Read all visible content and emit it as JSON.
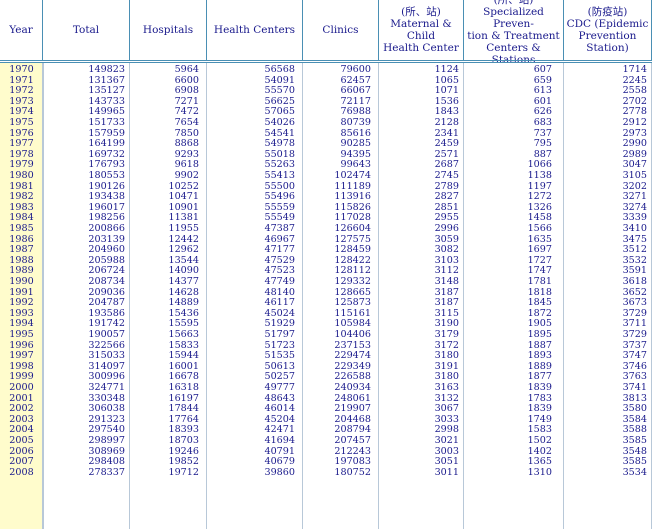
{
  "headers": [
    "Year",
    "Total",
    "Hospitals",
    "Health Centers",
    "Clinics",
    "(所、站)\nMaternal & Child\nHealth Center",
    "(所、站)\nSpecialized Preven-\ntion & Treatment\nCenters & Stations",
    "(防疫站)\nCDC (Epidemic\nPrevention\nStation)"
  ],
  "rows": [
    [
      "1970",
      "149823",
      "5964",
      "56568",
      "79600",
      "1124",
      "607",
      "1714"
    ],
    [
      "1971",
      "131367",
      "6600",
      "54091",
      "62457",
      "1065",
      "659",
      "2245"
    ],
    [
      "1972",
      "135127",
      "6908",
      "55570",
      "66067",
      "1071",
      "613",
      "2558"
    ],
    [
      "1973",
      "143733",
      "7271",
      "56625",
      "72117",
      "1536",
      "601",
      "2702"
    ],
    [
      "1974",
      "149965",
      "7472",
      "57065",
      "76988",
      "1843",
      "626",
      "2778"
    ],
    [
      "1975",
      "151733",
      "7654",
      "54026",
      "80739",
      "2128",
      "683",
      "2912"
    ],
    [
      "1976",
      "157959",
      "7850",
      "54541",
      "85616",
      "2341",
      "737",
      "2973"
    ],
    [
      "1977",
      "164199",
      "8868",
      "54978",
      "90285",
      "2459",
      "795",
      "2990"
    ],
    [
      "1978",
      "169732",
      "9293",
      "55018",
      "94395",
      "2571",
      "887",
      "2989"
    ],
    [
      "1979",
      "176793",
      "9618",
      "55263",
      "99643",
      "2687",
      "1066",
      "3047"
    ],
    [
      "1980",
      "180553",
      "9902",
      "55413",
      "102474",
      "2745",
      "1138",
      "3105"
    ],
    [
      "1981",
      "190126",
      "10252",
      "55500",
      "111189",
      "2789",
      "1197",
      "3202"
    ],
    [
      "1982",
      "193438",
      "10471",
      "55496",
      "113916",
      "2827",
      "1272",
      "3271"
    ],
    [
      "1983",
      "196017",
      "10901",
      "55559",
      "115826",
      "2851",
      "1326",
      "3274"
    ],
    [
      "1984",
      "198256",
      "11381",
      "55549",
      "117028",
      "2955",
      "1458",
      "3339"
    ],
    [
      "1985",
      "200866",
      "11955",
      "47387",
      "126604",
      "2996",
      "1566",
      "3410"
    ],
    [
      "1986",
      "203139",
      "12442",
      "46967",
      "127575",
      "3059",
      "1635",
      "3475"
    ],
    [
      "1987",
      "204960",
      "12962",
      "47177",
      "128459",
      "3082",
      "1697",
      "3512"
    ],
    [
      "1988",
      "205988",
      "13544",
      "47529",
      "128422",
      "3103",
      "1727",
      "3532"
    ],
    [
      "1989",
      "206724",
      "14090",
      "47523",
      "128112",
      "3112",
      "1747",
      "3591"
    ],
    [
      "1990",
      "208734",
      "14377",
      "47749",
      "129332",
      "3148",
      "1781",
      "3618"
    ],
    [
      "1991",
      "209036",
      "14628",
      "48140",
      "128665",
      "3187",
      "1818",
      "3652"
    ],
    [
      "1992",
      "204787",
      "14889",
      "46117",
      "125873",
      "3187",
      "1845",
      "3673"
    ],
    [
      "1993",
      "193586",
      "15436",
      "45024",
      "115161",
      "3115",
      "1872",
      "3729"
    ],
    [
      "1994",
      "191742",
      "15595",
      "51929",
      "105984",
      "3190",
      "1905",
      "3711"
    ],
    [
      "1995",
      "190057",
      "15663",
      "51797",
      "104406",
      "3179",
      "1895",
      "3729"
    ],
    [
      "1996",
      "322566",
      "15833",
      "51723",
      "237153",
      "3172",
      "1887",
      "3737"
    ],
    [
      "1997",
      "315033",
      "15944",
      "51535",
      "229474",
      "3180",
      "1893",
      "3747"
    ],
    [
      "1998",
      "314097",
      "16001",
      "50613",
      "229349",
      "3191",
      "1889",
      "3746"
    ],
    [
      "1999",
      "300996",
      "16678",
      "50257",
      "226588",
      "3180",
      "1877",
      "3763"
    ],
    [
      "2000",
      "324771",
      "16318",
      "49777",
      "240934",
      "3163",
      "1839",
      "3741"
    ],
    [
      "2001",
      "330348",
      "16197",
      "48643",
      "248061",
      "3132",
      "1783",
      "3813"
    ],
    [
      "2002",
      "306038",
      "17844",
      "46014",
      "219907",
      "3067",
      "1839",
      "3580"
    ],
    [
      "2003",
      "291323",
      "17764",
      "45204",
      "204468",
      "3033",
      "1749",
      "3584"
    ],
    [
      "2004",
      "297540",
      "18393",
      "42471",
      "208794",
      "2998",
      "1583",
      "3588"
    ],
    [
      "2005",
      "298997",
      "18703",
      "41694",
      "207457",
      "3021",
      "1502",
      "3585"
    ],
    [
      "2006",
      "308969",
      "19246",
      "40791",
      "212243",
      "3003",
      "1402",
      "3548"
    ],
    [
      "2007",
      "298408",
      "19852",
      "40679",
      "197083",
      "3051",
      "1365",
      "3585"
    ],
    [
      "2008",
      "278337",
      "19712",
      "39860",
      "180752",
      "3011",
      "1310",
      "3534"
    ]
  ]
}
